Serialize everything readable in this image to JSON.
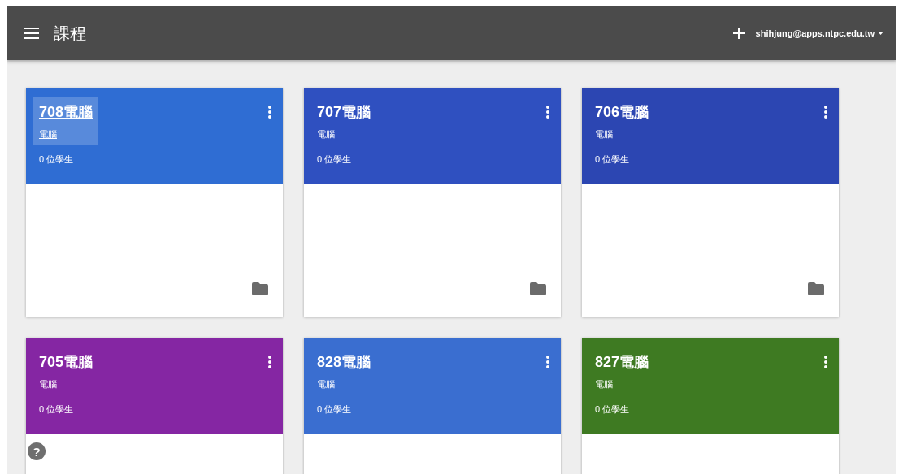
{
  "top_bar": {
    "title": "課程",
    "account": "shihjung@apps.ntpc.edu.tw"
  },
  "courses": [
    {
      "name": "708電腦",
      "section": "電腦",
      "students": "0 位學生",
      "color": "#2f6dd3",
      "hovered": true
    },
    {
      "name": "707電腦",
      "section": "電腦",
      "students": "0 位學生",
      "color": "#2f50c0",
      "hovered": false
    },
    {
      "name": "706電腦",
      "section": "電腦",
      "students": "0 位學生",
      "color": "#2c46b2",
      "hovered": false
    },
    {
      "name": "705電腦",
      "section": "電腦",
      "students": "0 位學生",
      "color": "#8526a3",
      "hovered": false
    },
    {
      "name": "828電腦",
      "section": "電腦",
      "students": "0 位學生",
      "color": "#3a6ed0",
      "hovered": false
    },
    {
      "name": "827電腦",
      "section": "電腦",
      "students": "0 位學生",
      "color": "#3e7a22",
      "hovered": false
    }
  ],
  "help": "?"
}
